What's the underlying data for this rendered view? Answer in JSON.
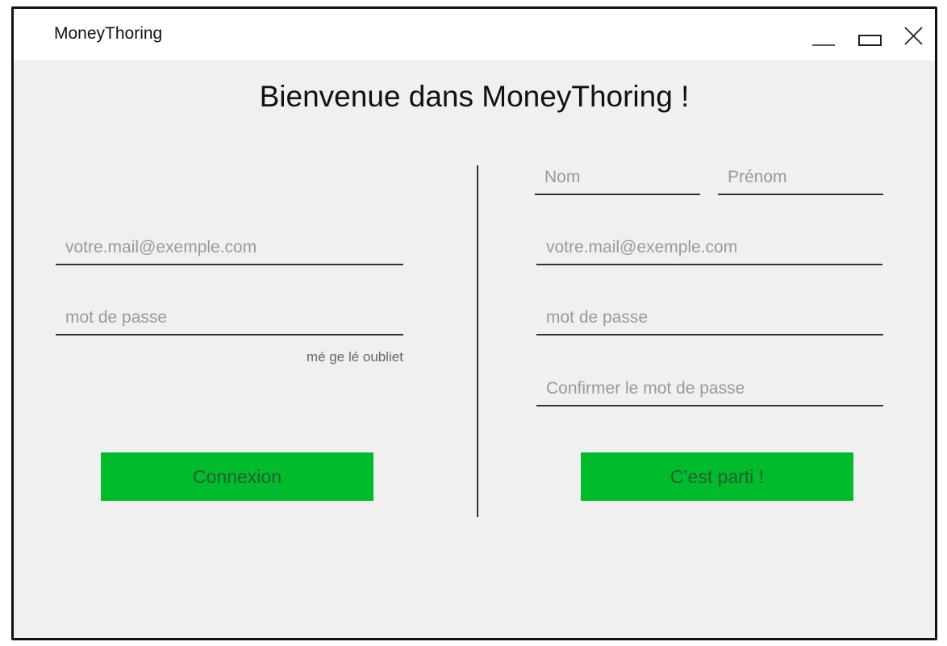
{
  "window": {
    "title": "MoneyThoring",
    "controls": [
      "minimize-icon",
      "maximize-icon",
      "close-icon"
    ]
  },
  "main": {
    "heading": "Bienvenue dans MoneyThoring !"
  },
  "login": {
    "email_placeholder": "votre.mail@exemple.com",
    "email_value": "",
    "password_placeholder": "mot de passe",
    "password_value": "",
    "forgot_label": "mé ge lé oubliet",
    "submit_label": "Connexion"
  },
  "signup": {
    "last_name_placeholder": "Nom",
    "first_name_placeholder": "Prénom",
    "email_placeholder": "votre.mail@exemple.com",
    "password_placeholder": "mot de passe",
    "confirm_placeholder": "Confirmer le mot de passe",
    "submit_label": "C’est parti !"
  },
  "colors": {
    "button_bg": "#00bc2d",
    "button_text": "#2b5a33",
    "window_bg": "#f0f0f0",
    "titlebar_bg": "#ffffff",
    "placeholder": "#9a9a9a"
  }
}
